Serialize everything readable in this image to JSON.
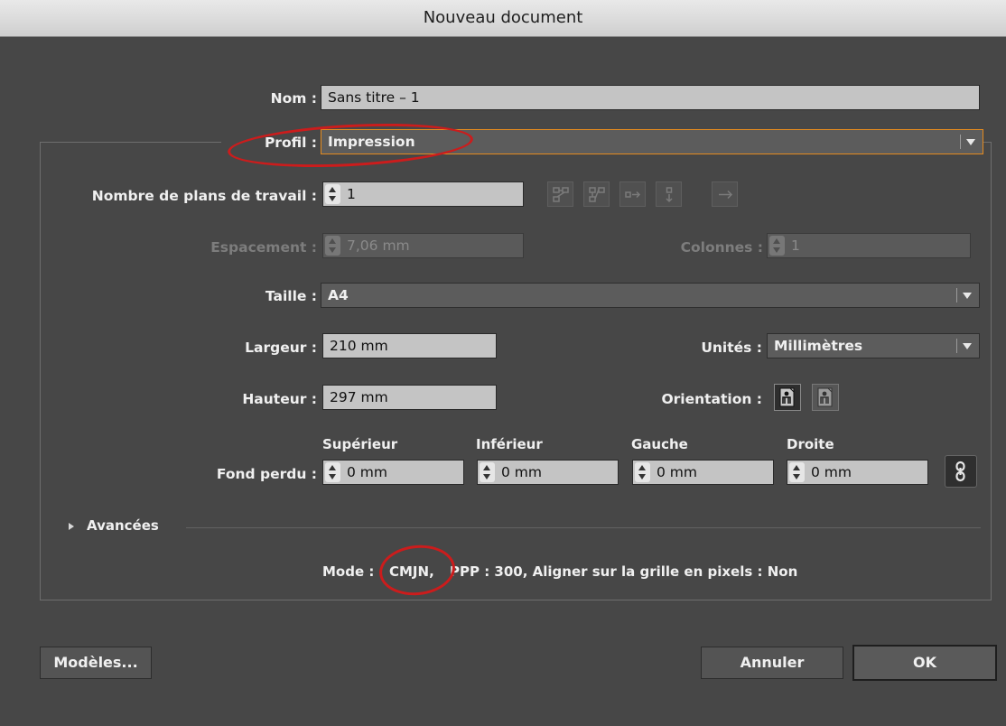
{
  "window": {
    "title": "Nouveau document"
  },
  "form": {
    "nom": {
      "label": "Nom :",
      "value": "Sans titre – 1"
    },
    "profil": {
      "label": "Profil :",
      "value": "Impression"
    },
    "plans": {
      "label": "Nombre de plans de travail :",
      "value": "1"
    },
    "espacement": {
      "label": "Espacement :",
      "value": "7,06 mm"
    },
    "colonnes": {
      "label": "Colonnes :",
      "value": "1"
    },
    "taille": {
      "label": "Taille :",
      "value": "A4"
    },
    "largeur": {
      "label": "Largeur :",
      "value": "210 mm"
    },
    "unites": {
      "label": "Unités :",
      "value": "Millimètres"
    },
    "hauteur": {
      "label": "Hauteur :",
      "value": "297 mm"
    },
    "orientation": {
      "label": "Orientation :"
    },
    "fond_perdu": {
      "label": "Fond perdu :",
      "superieur": {
        "label": "Supérieur",
        "value": "0 mm"
      },
      "inferieur": {
        "label": "Inférieur",
        "value": "0 mm"
      },
      "gauche": {
        "label": "Gauche",
        "value": "0 mm"
      },
      "droite": {
        "label": "Droite",
        "value": "0 mm"
      }
    },
    "avancees": {
      "label": "Avancées"
    },
    "summary": {
      "prefix": "Mode :",
      "mode": "CMJN,",
      "rest": "PPP : 300, Aligner sur la grille en pixels : Non"
    }
  },
  "buttons": {
    "modeles": "Modèles...",
    "annuler": "Annuler",
    "ok": "OK"
  },
  "icons": {
    "artboard_layout": [
      "grid-by-row-icon",
      "grid-by-column-icon",
      "arrange-by-row-icon",
      "arrange-by-column-icon",
      "right-to-left-icon"
    ],
    "orientation": [
      "portrait-orientation-icon",
      "landscape-orientation-icon"
    ],
    "link": "chain-link-icon",
    "disclosure": "disclosure-triangle-icon",
    "dropdown": "dropdown-arrow-icon"
  },
  "colors": {
    "focus_border": "#e58b1e",
    "annotation": "#cc1c1c",
    "dialog_bg": "#474747"
  }
}
